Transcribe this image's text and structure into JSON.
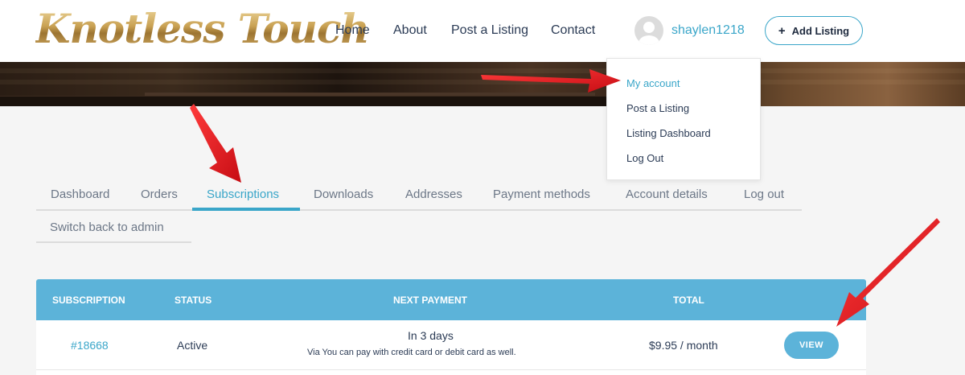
{
  "site": {
    "logo_text": "Knotless Touch"
  },
  "nav": {
    "items": [
      "Home",
      "About",
      "Post a Listing",
      "Contact"
    ]
  },
  "user": {
    "username": "shaylen1218"
  },
  "add_listing": {
    "icon": "plus-icon",
    "label": "Add Listing"
  },
  "dropdown": {
    "items": [
      "My account",
      "Post a Listing",
      "Listing Dashboard",
      "Log Out"
    ],
    "active_index": 0
  },
  "tabs": {
    "items": [
      "Dashboard",
      "Orders",
      "Subscriptions",
      "Downloads",
      "Addresses",
      "Payment methods",
      "Account details",
      "Log out"
    ],
    "active": "Subscriptions",
    "second_row": [
      "Switch back to admin"
    ]
  },
  "table": {
    "headers": [
      "SUBSCRIPTION",
      "STATUS",
      "NEXT PAYMENT",
      "TOTAL"
    ],
    "rows": [
      {
        "subscription": "#18668",
        "status": "Active",
        "next_payment": "In 3 days",
        "payment_note": "Via You can pay with credit card or debit card as well.",
        "total": "$9.95 / month",
        "action": "VIEW"
      }
    ]
  },
  "colors": {
    "accent": "#3aa6c9",
    "table_header": "#5cb3d9",
    "annotation_arrow": "#e3141b"
  }
}
